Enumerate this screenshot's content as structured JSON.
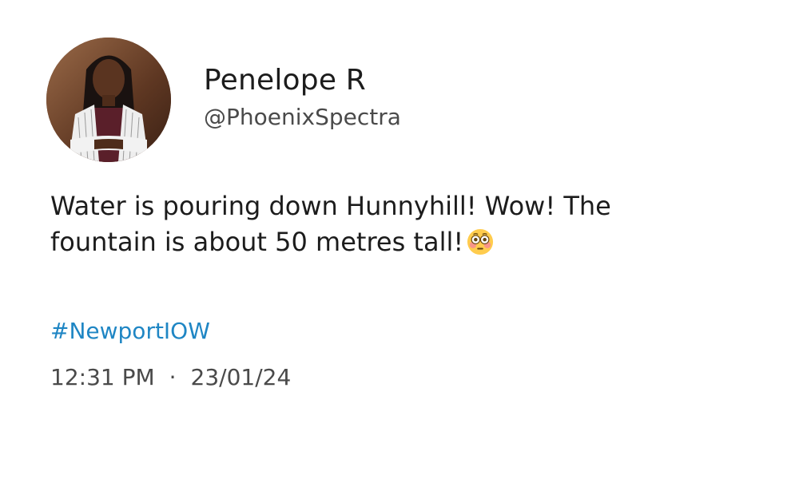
{
  "profile": {
    "display_name": "Penelope R",
    "handle": "@PhoenixSpectra",
    "avatar_icon": "profile-photo"
  },
  "tweet": {
    "text_line_1": "Water is pouring down Hunnyhill! Wow! The",
    "text_line_2": "fountain is about 50 metres tall!",
    "emoji": "flushed-face-emoji",
    "hashtag": "#NewportIOW"
  },
  "meta": {
    "time": "12:31 PM",
    "separator": "·",
    "date": "23/01/24"
  },
  "colors": {
    "hashtag": "#1f86c4",
    "text": "#1c1c1c",
    "secondary_text": "#4a4a4a",
    "background": "#ffffff"
  }
}
